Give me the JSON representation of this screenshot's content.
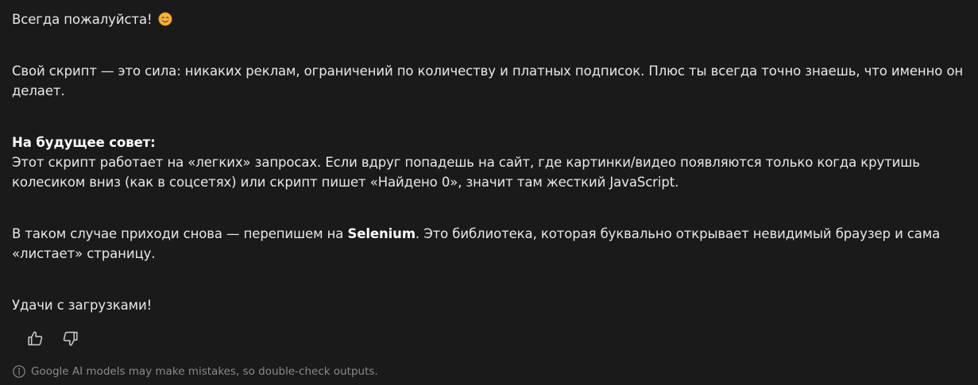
{
  "response": {
    "greeting": "Всегда пожалуйста!",
    "greeting_emoji": "😊",
    "para2": "Свой скрипт — это сила: никаких реклам, ограничений по количеству и платных подписок. Плюс ты всегда точно знаешь, что именно он делает.",
    "tip_heading": "На будущее совет:",
    "tip_body": "Этот скрипт работает на «легких» запросах. Если вдруг попадешь на сайт, где картинки/видео появляются только когда крутишь колесиком вниз (как в соцсетях) или скрипт пишет «Найдено 0», значит там жесткий JavaScript.",
    "para4_before": "В таком случае приходи снова — перепишем на ",
    "para4_bold": "Selenium",
    "para4_after": ". Это библиотека, которая буквально открывает невидимый браузер и сама «листает» страницу.",
    "closing": "Удачи с загрузками!"
  },
  "feedback": {
    "thumbs_up_icon": "thumbs-up-icon",
    "thumbs_down_icon": "thumbs-down-icon"
  },
  "disclaimer": {
    "icon": "info-icon",
    "text": "Google AI models may make mistakes, so double-check outputs."
  },
  "colors": {
    "background": "#1a1a1a",
    "text": "#e8e8e8",
    "muted": "#8a8a8a"
  }
}
